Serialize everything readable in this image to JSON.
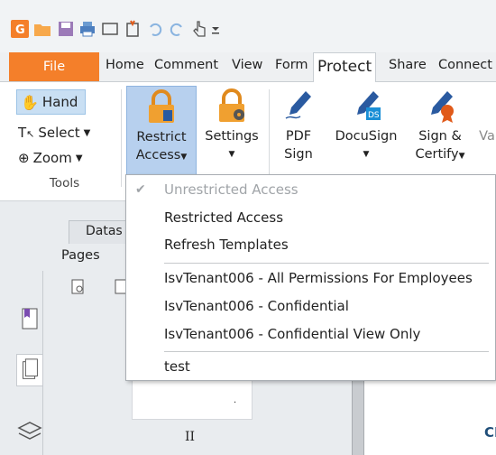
{
  "menubar": {
    "file": "File",
    "tabs": [
      "Home",
      "Comment",
      "View",
      "Form"
    ],
    "active": "Protect",
    "tabs_after": [
      "Share",
      "Connect"
    ]
  },
  "ribbon": {
    "tools": {
      "hand": "Hand",
      "select": "Select",
      "zoom": "Zoom",
      "group_label": "Tools"
    },
    "restrict": {
      "line1": "Restrict",
      "line2": "Access"
    },
    "settings": {
      "line1": "Settings"
    },
    "pdf_sign": {
      "line1": "PDF",
      "line2": "Sign"
    },
    "docusign": {
      "line1": "DocuSign"
    },
    "sign_certify": {
      "line1": "Sign &",
      "line2": "Certify"
    },
    "overflow": "Va"
  },
  "left_pane": {
    "datas_tab": "Datas",
    "pages_label": "Pages",
    "page_numeral": "II"
  },
  "doc": {
    "partial_text": "CI"
  },
  "dropdown": {
    "items": [
      "Unrestricted Access",
      "Restricted Access",
      "Refresh Templates",
      "IsvTenant006 - All Permissions For Employees",
      "IsvTenant006 - Confidential",
      "IsvTenant006 - Confidential View Only",
      "test"
    ]
  },
  "colors": {
    "accent": "#f47f2a",
    "selected": "#b7d0ee"
  }
}
